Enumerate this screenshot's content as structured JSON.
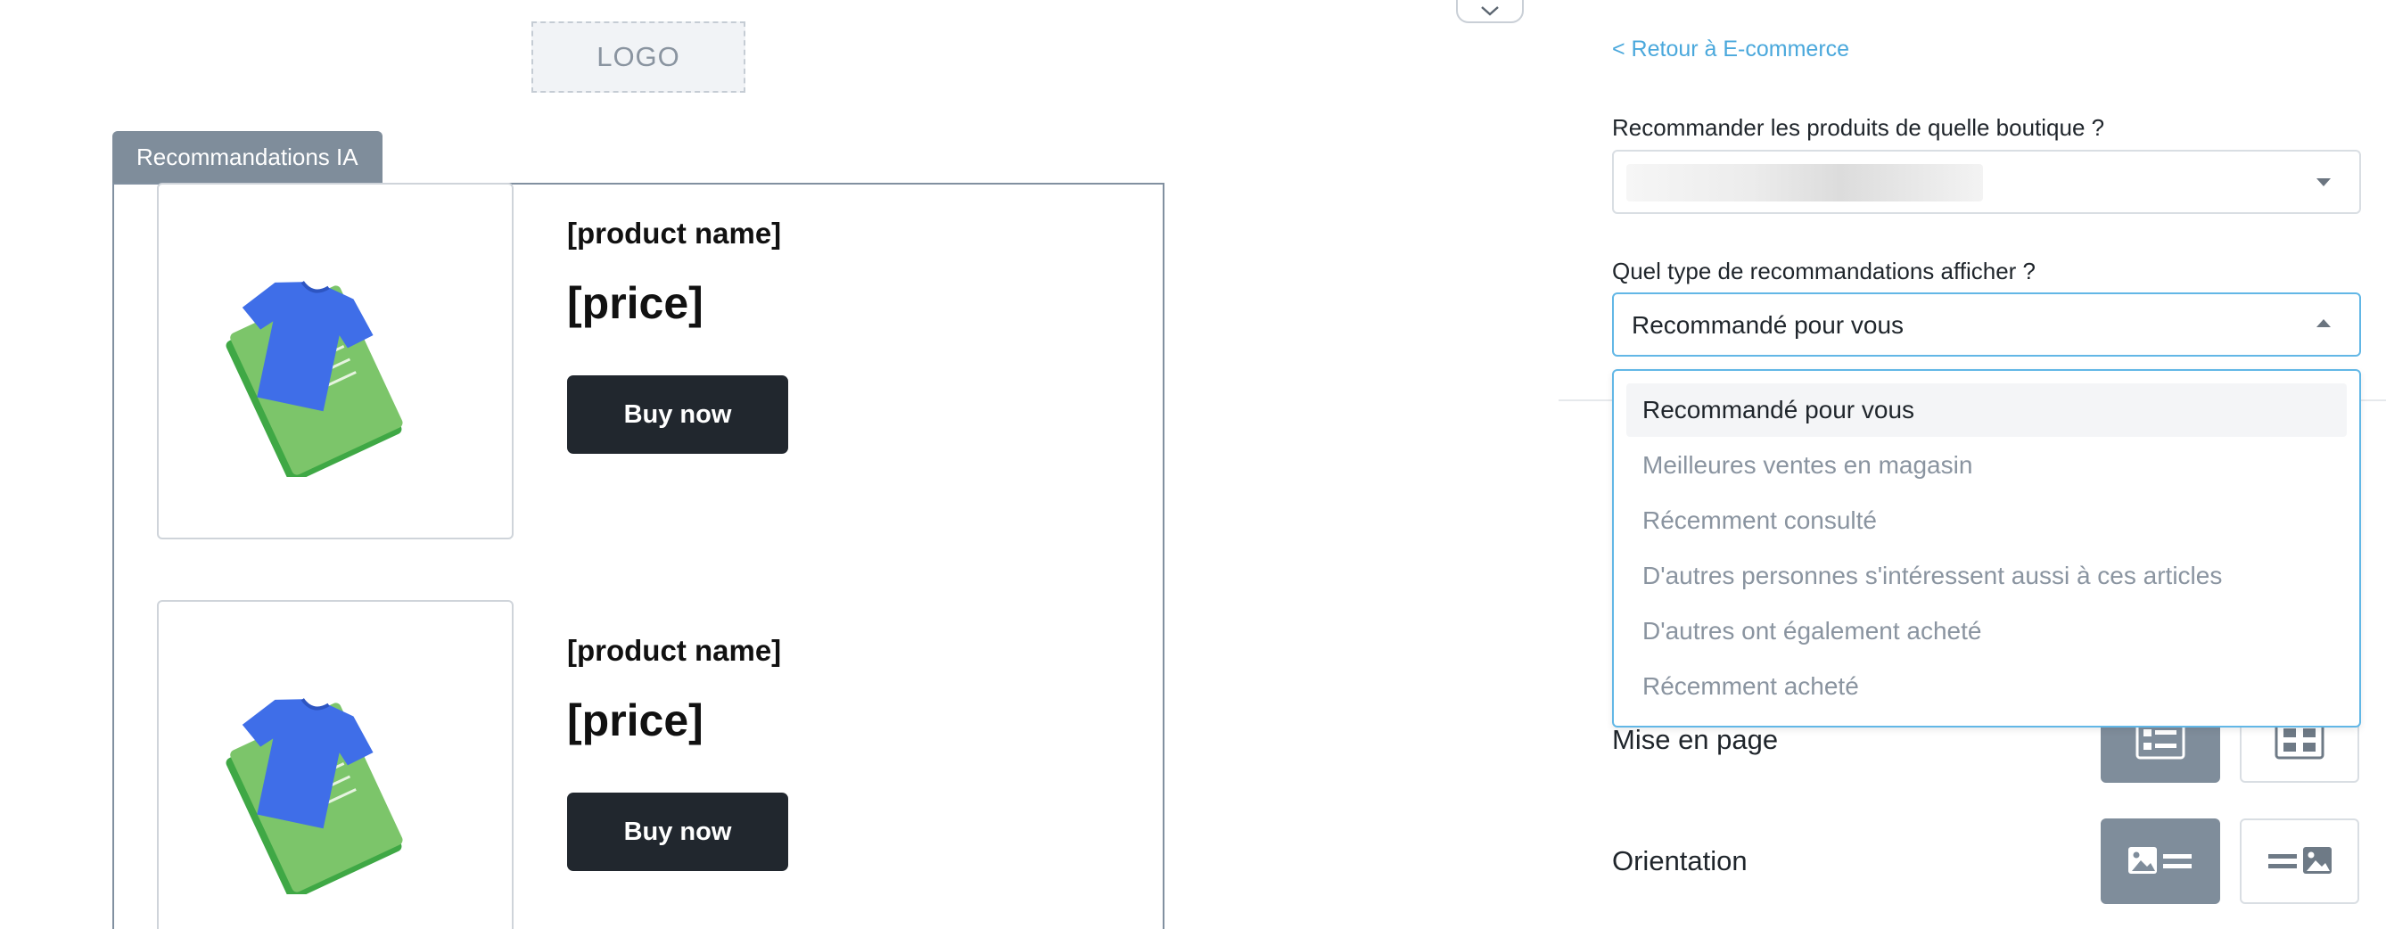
{
  "canvas": {
    "logo_text": "LOGO",
    "block_tab_label": "Recommandations IA",
    "products": [
      {
        "name": "[product name]",
        "price": "[price]",
        "button": "Buy now"
      },
      {
        "name": "[product name]",
        "price": "[price]",
        "button": "Buy now"
      }
    ]
  },
  "panel": {
    "back_link": "< Retour à E-commerce",
    "shop_question": "Recommander les produits de quelle boutique ?",
    "shop_value": "",
    "type_question": "Quel type de recommandations afficher ?",
    "type_value": "Recommandé pour vous",
    "type_options": [
      "Recommandé pour vous",
      "Meilleures ventes en magasin",
      "Récemment consulté",
      "D'autres personnes s'intéressent aussi à ces articles",
      "D'autres ont également acheté",
      "Récemment acheté"
    ],
    "layout_label": "Mise en page",
    "orientation_label": "Orientation"
  },
  "colors": {
    "accent": "#4aa8dc",
    "focus_border": "#62b7e6",
    "active_option": "#7f8d9b",
    "button_dark": "#21272e"
  }
}
